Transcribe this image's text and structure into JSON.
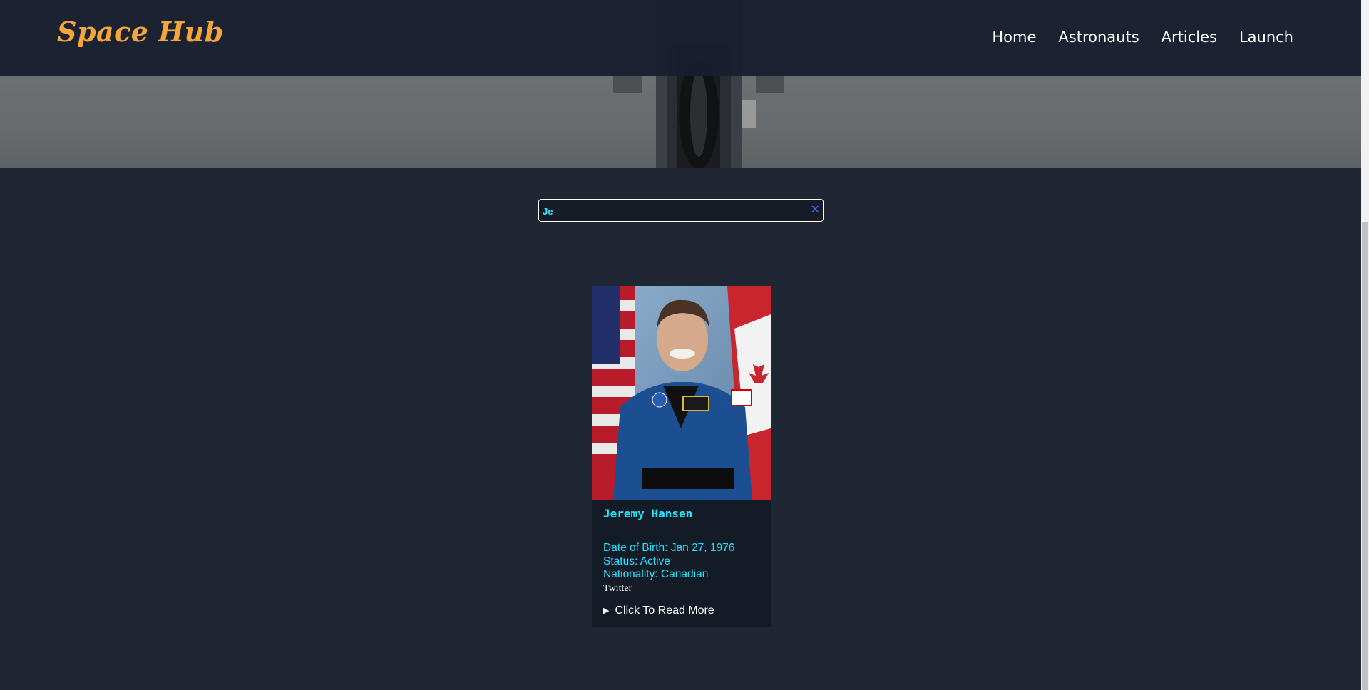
{
  "header": {
    "brand": "Space Hub",
    "nav": [
      "Home",
      "Astronauts",
      "Articles",
      "Launch"
    ]
  },
  "search": {
    "value": "Je",
    "placeholder": "",
    "clear_icon": "close-icon"
  },
  "card": {
    "name": "Jeremy Hansen",
    "dob": "Date of Birth: Jan 27, 1976",
    "status": "Status: Active",
    "nationality": "Nationality: Canadian",
    "link": "Twitter",
    "read_more": "Click To Read More"
  },
  "colors": {
    "background": "#1f2735",
    "navbar": "#171f2e",
    "brand": "#f5a53a",
    "accent": "#19e6ff"
  }
}
